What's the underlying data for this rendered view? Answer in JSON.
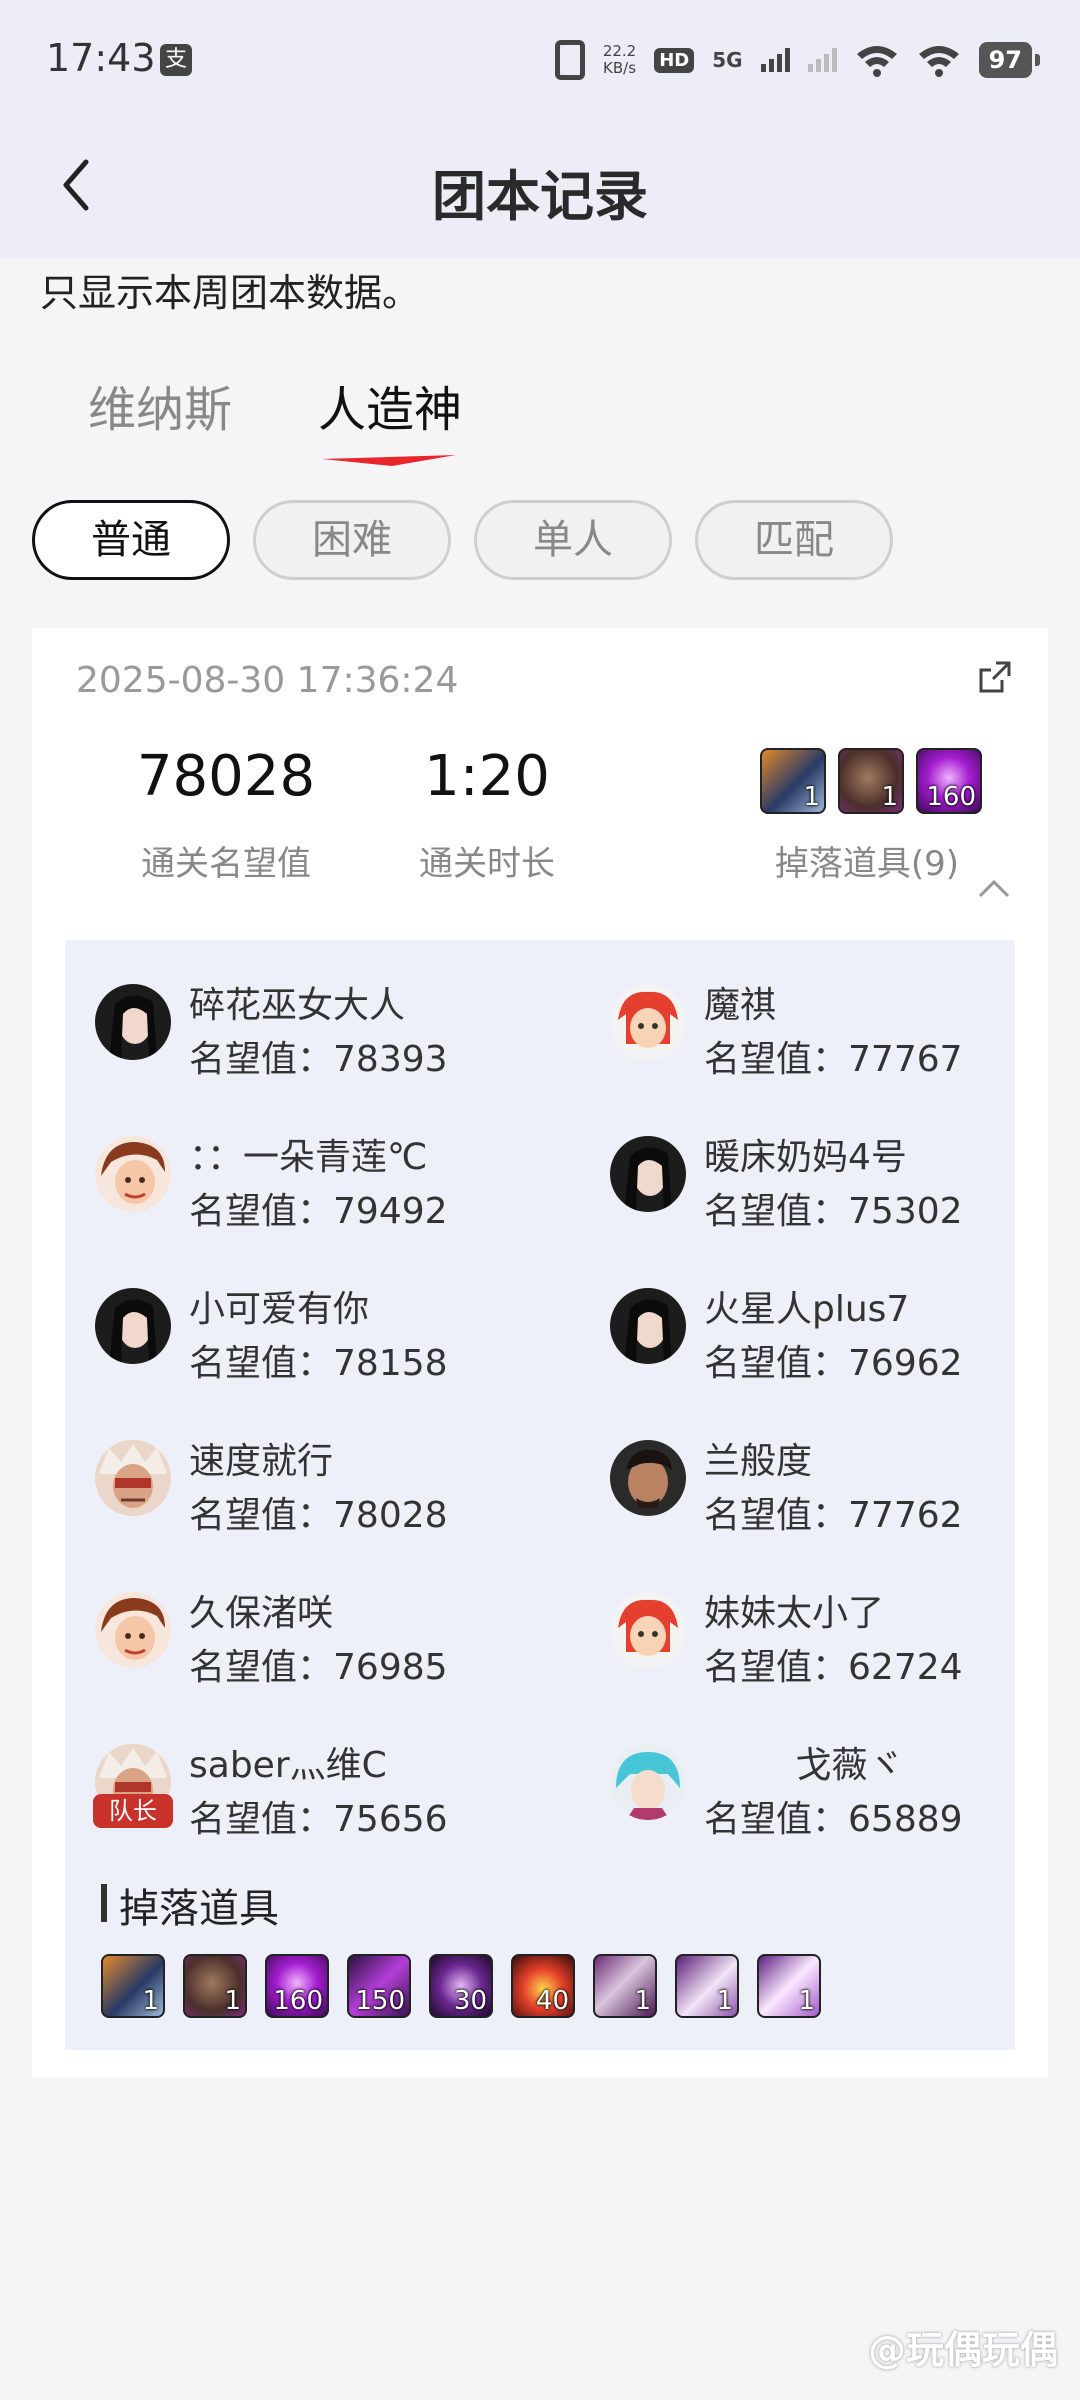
{
  "status_bar": {
    "time": "17:43",
    "alipay_icon": "alipay-icon",
    "net_speed_value": "22.2",
    "net_speed_unit": "KB/s",
    "hd_label": "HD",
    "sim1_label": "1",
    "network_label": "5G",
    "battery": "97"
  },
  "nav": {
    "back_icon": "back-chevron-icon",
    "title": "团本记录"
  },
  "notice": "只显示本周团本数据。",
  "raid_tabs": [
    {
      "label": "维纳斯",
      "active": false
    },
    {
      "label": "人造神",
      "active": true
    }
  ],
  "accent_color": "#e8262b",
  "modes": [
    {
      "label": "普通",
      "active": true
    },
    {
      "label": "困难",
      "active": false
    },
    {
      "label": "单人",
      "active": false
    },
    {
      "label": "匹配",
      "active": false
    }
  ],
  "record": {
    "timestamp": "2025-08-30 17:36:24",
    "share_icon": "share-icon",
    "fame_value": "78028",
    "fame_label": "通关名望值",
    "duration_value": "1:20",
    "duration_label": "通关时长",
    "drops_label": "掉落道具(9)",
    "collapse_icon": "chevron-up-icon",
    "preview_drops": [
      {
        "name": "armor-item-icon",
        "qty": "1"
      },
      {
        "name": "portrait-item-icon",
        "qty": "1"
      },
      {
        "name": "purple-orb-icon",
        "qty": "160"
      }
    ],
    "members": [
      {
        "name": "碎花巫女大人",
        "score_label": "名望值：",
        "score": "78393",
        "captain": false
      },
      {
        "name": "魔祺",
        "score_label": "名望值：",
        "score": "77767",
        "captain": false
      },
      {
        "name": "：：一朵青莲℃",
        "score_label": "名望值：",
        "score": "79492",
        "captain": false
      },
      {
        "name": "暖床奶妈4号",
        "score_label": "名望值：",
        "score": "75302",
        "captain": false
      },
      {
        "name": "小可爱有你",
        "score_label": "名望值：",
        "score": "78158",
        "captain": false
      },
      {
        "name": "火星人plus7",
        "score_label": "名望值：",
        "score": "76962",
        "captain": false
      },
      {
        "name": "速度就行",
        "score_label": "名望值：",
        "score": "78028",
        "captain": false
      },
      {
        "name": "兰般度",
        "score_label": "名望值：",
        "score": "77762",
        "captain": false
      },
      {
        "name": "久保渚咲",
        "score_label": "名望值：",
        "score": "76985",
        "captain": false
      },
      {
        "name": "妹妹太小了",
        "score_label": "名望值：",
        "score": "62724",
        "captain": false
      },
      {
        "name": "saber灬维C",
        "score_label": "名望值：",
        "score": "75656",
        "captain": true
      },
      {
        "name": "        戈薇ヾ",
        "score_label": "名望值：",
        "score": "65889",
        "captain": false
      }
    ],
    "captain_label": "队长",
    "drops_section_title": "掉落道具",
    "drops": [
      {
        "name": "armor-item-icon",
        "qty": "1"
      },
      {
        "name": "portrait-item-icon",
        "qty": "1"
      },
      {
        "name": "purple-orb-icon",
        "qty": "160"
      },
      {
        "name": "purple-crystal-icon",
        "qty": "150"
      },
      {
        "name": "swirl-stone-icon",
        "qty": "30"
      },
      {
        "name": "fire-orb-icon",
        "qty": "40"
      },
      {
        "name": "chest-box-icon",
        "qty": "1"
      },
      {
        "name": "boot-item-icon",
        "qty": "1"
      },
      {
        "name": "scroll-item-icon",
        "qty": "1"
      }
    ]
  },
  "watermark": "@玩偶玩偶"
}
